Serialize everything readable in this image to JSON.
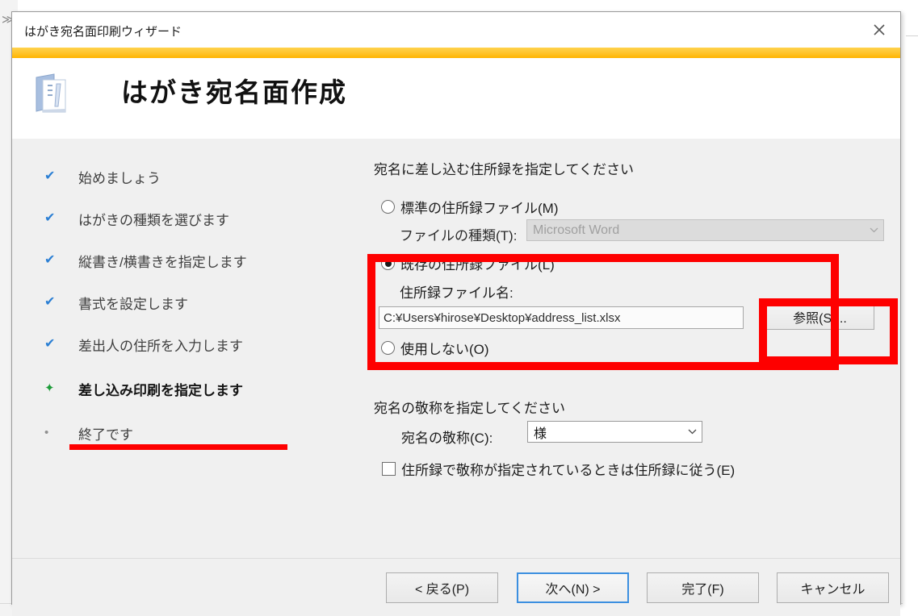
{
  "window": {
    "title": "はがき宛名面印刷ウィザード",
    "close_icon": "close-icon",
    "accent_color": "#ffc52e"
  },
  "header": {
    "icon": "word-document-icon",
    "title": "はがき宛名面作成"
  },
  "steps": [
    {
      "label": "始めましょう",
      "state": "done",
      "marker": "✔"
    },
    {
      "label": "はがきの種類を選びます",
      "state": "done",
      "marker": "✔"
    },
    {
      "label": "縦書き/横書きを指定します",
      "state": "done",
      "marker": "✔"
    },
    {
      "label": "書式を設定します",
      "state": "done",
      "marker": "✔"
    },
    {
      "label": "差出人の住所を入力します",
      "state": "done",
      "marker": "✔"
    },
    {
      "label": "差し込み印刷を指定します",
      "state": "current",
      "marker": "✦"
    },
    {
      "label": "終了です",
      "state": "todo",
      "marker": "•"
    }
  ],
  "panel": {
    "prompt_source": "宛名に差し込む住所録を指定してください",
    "radio_standard": "標準の住所録ファイル(M)",
    "file_type_label": "ファイルの種類(T):",
    "file_type_value": "Microsoft Word",
    "radio_existing": "既存の住所録ファイル(L)",
    "file_name_label": "住所録ファイル名:",
    "file_name_value": "C:¥Users¥hirose¥Desktop¥address_list.xlsx",
    "browse_button": "参照(S)...",
    "radio_none": "使用しない(O)",
    "prompt_honorific": "宛名の敬称を指定してください",
    "honorific_label": "宛名の敬称(C):",
    "honorific_value": "様",
    "checkbox_follow": "住所録で敬称が指定されているときは住所録に従う(E)"
  },
  "footer": {
    "back": "< 戻る(P)",
    "next": "次へ(N) >",
    "finish": "完了(F)",
    "cancel": "キャンセル"
  },
  "annotations": {
    "highlight_color": "#fe0000",
    "box_existing_file": "既存の住所録ファイル(L) セクション強調",
    "box_browse": "参照(S)... ボタン強調",
    "underline_step": "差し込み印刷を指定します 下線"
  }
}
